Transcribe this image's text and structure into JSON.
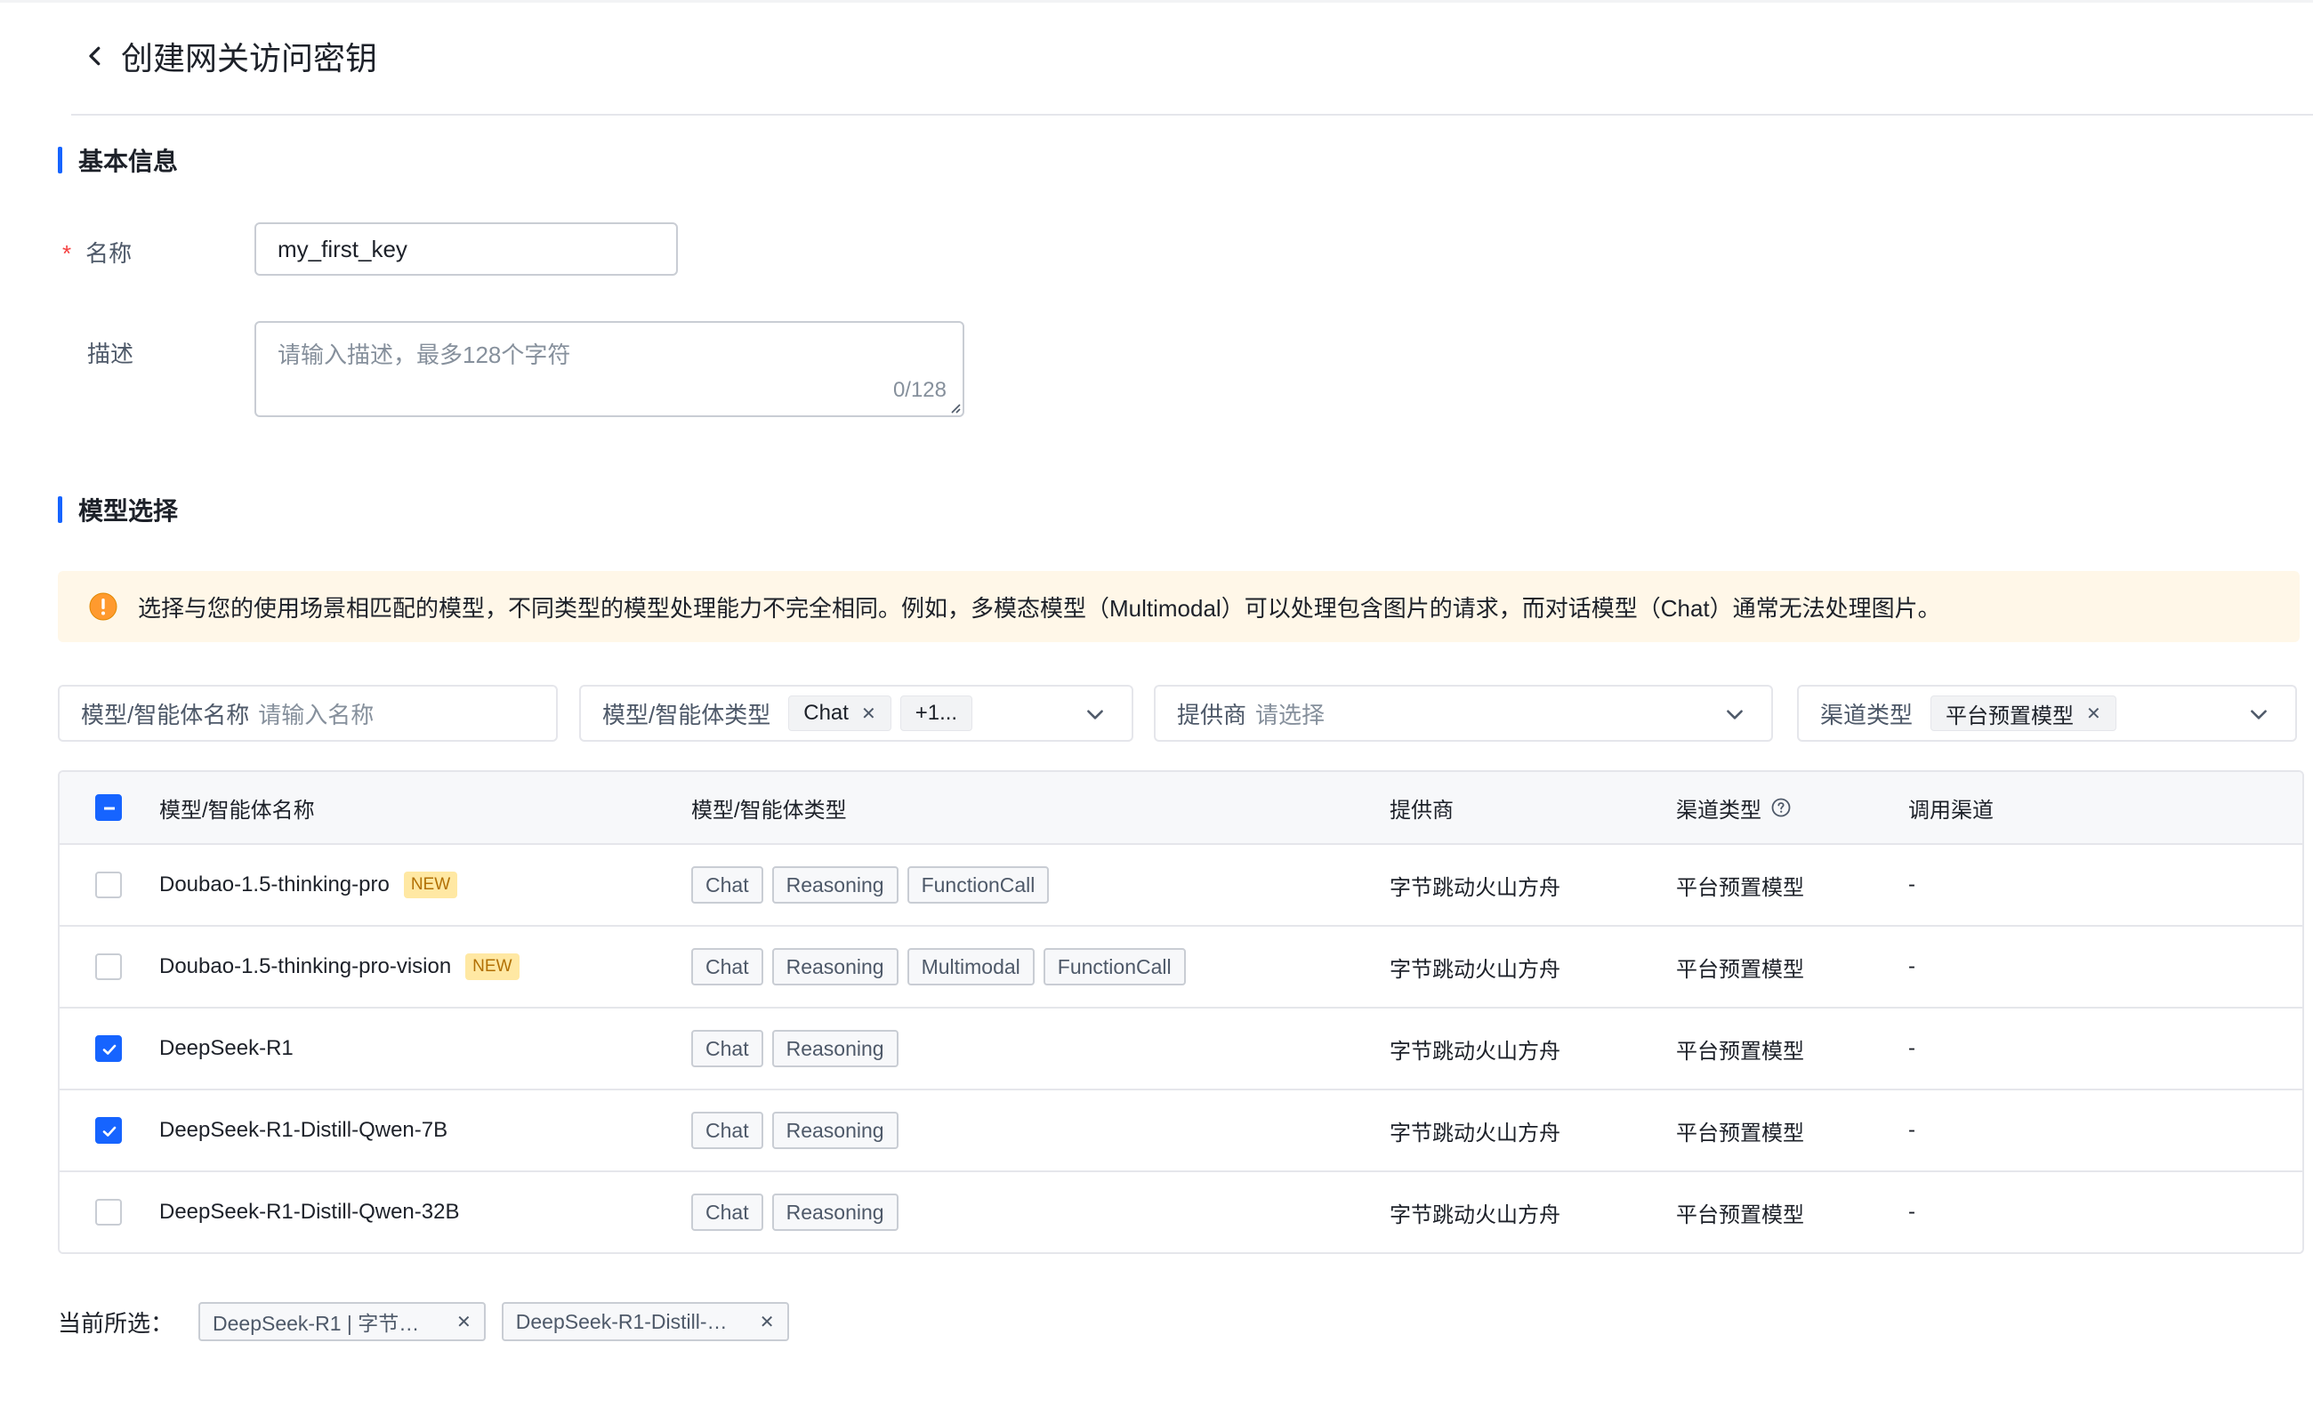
{
  "page": {
    "title": "创建网关访问密钥"
  },
  "basic": {
    "section_title": "基本信息",
    "name_label": "名称",
    "name_required": "*",
    "name_value": "my_first_key",
    "desc_label": "描述",
    "desc_placeholder": "请输入描述，最多128个字符",
    "desc_count": "0/128"
  },
  "model": {
    "section_title": "模型选择",
    "alert": "选择与您的使用场景相匹配的模型，不同类型的模型处理能力不完全相同。例如，多模态模型（Multimodal）可以处理包含图片的请求，而对话模型（Chat）通常无法处理图片。"
  },
  "filters": {
    "name": {
      "label": "模型/智能体名称",
      "placeholder": "请输入名称"
    },
    "type": {
      "label": "模型/智能体类型",
      "chip": "Chat",
      "more": "+1..."
    },
    "provider": {
      "label": "提供商",
      "placeholder": "请选择"
    },
    "channel": {
      "label": "渠道类型",
      "chip": "平台预置模型"
    }
  },
  "table": {
    "headers": {
      "name": "模型/智能体名称",
      "type": "模型/智能体类型",
      "provider": "提供商",
      "channel": "渠道类型",
      "route": "调用渠道"
    },
    "rows": [
      {
        "name": "Doubao-1.5-thinking-pro",
        "badge": "NEW",
        "tags": [
          "Chat",
          "Reasoning",
          "FunctionCall"
        ],
        "provider": "字节跳动火山方舟",
        "channel": "平台预置模型",
        "route": "-",
        "checked": false
      },
      {
        "name": "Doubao-1.5-thinking-pro-vision",
        "badge": "NEW",
        "tags": [
          "Chat",
          "Reasoning",
          "Multimodal",
          "FunctionCall"
        ],
        "provider": "字节跳动火山方舟",
        "channel": "平台预置模型",
        "route": "-",
        "checked": false
      },
      {
        "name": "DeepSeek-R1",
        "badge": "",
        "tags": [
          "Chat",
          "Reasoning"
        ],
        "provider": "字节跳动火山方舟",
        "channel": "平台预置模型",
        "route": "-",
        "checked": true
      },
      {
        "name": "DeepSeek-R1-Distill-Qwen-7B",
        "badge": "",
        "tags": [
          "Chat",
          "Reasoning"
        ],
        "provider": "字节跳动火山方舟",
        "channel": "平台预置模型",
        "route": "-",
        "checked": true
      },
      {
        "name": "DeepSeek-R1-Distill-Qwen-32B",
        "badge": "",
        "tags": [
          "Chat",
          "Reasoning"
        ],
        "provider": "字节跳动火山方舟",
        "channel": "平台预置模型",
        "route": "-",
        "checked": false
      }
    ]
  },
  "selection": {
    "label": "当前所选：",
    "chips": [
      "DeepSeek-R1 | 字节跳...",
      "DeepSeek-R1-Distill-Q..."
    ]
  },
  "colors": {
    "accent": "#1664ff",
    "warning": "#ff9a2e",
    "alert_bg": "#fff7e8"
  },
  "icons": {
    "back": "chevron-left-icon",
    "alert": "warning-icon",
    "dropdown": "chevron-down-icon",
    "help": "question-circle-icon",
    "remove": "close-icon"
  }
}
